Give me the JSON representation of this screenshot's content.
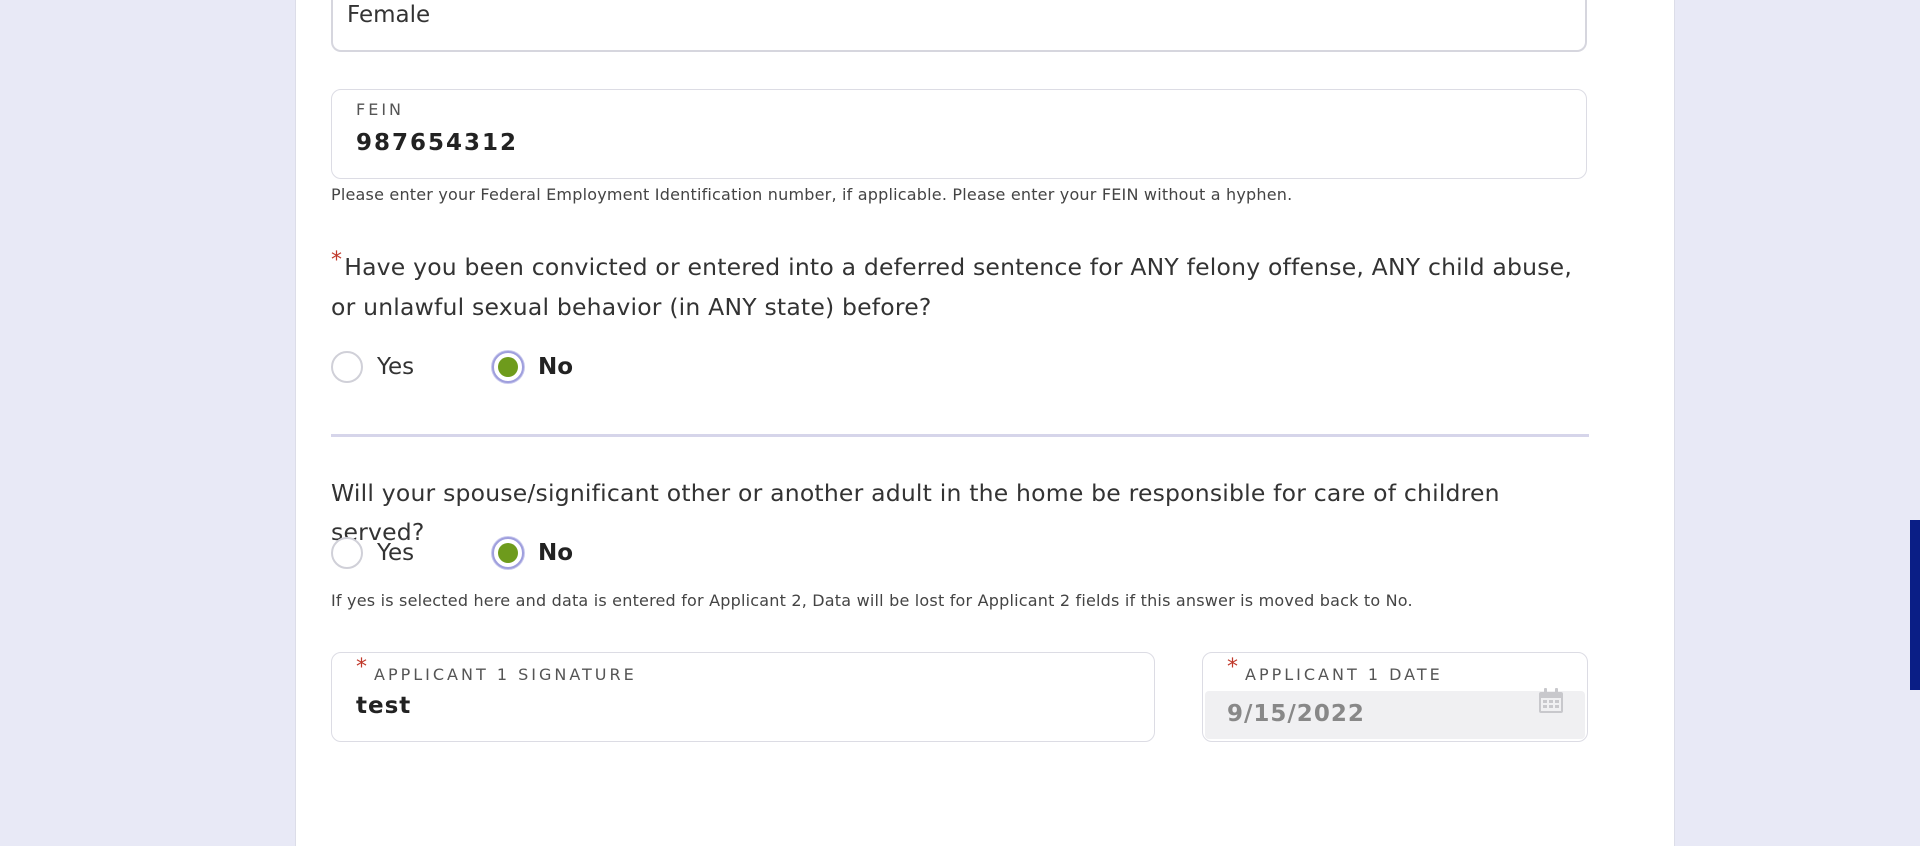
{
  "gender": {
    "value": "Female"
  },
  "fein": {
    "label": "FEIN",
    "value": "987654312",
    "help": "Please enter your Federal Employment Identification number, if applicable. Please enter your FEIN without a hyphen."
  },
  "felony_question": {
    "required_mark": "*",
    "text": "Have you been convicted or entered into a deferred sentence for ANY felony offense, ANY child abuse, or unlawful sexual behavior (in ANY state) before?",
    "options": [
      {
        "label": "Yes",
        "selected": false
      },
      {
        "label": "No",
        "selected": true
      }
    ]
  },
  "spouse_question": {
    "text": "Will your spouse/significant other or another adult in the home be responsible for care of children served?",
    "options": [
      {
        "label": "Yes",
        "selected": false
      },
      {
        "label": "No",
        "selected": true
      }
    ],
    "help": "If yes is selected here and data is entered for Applicant 2, Data will be lost for Applicant 2 fields if this answer is moved back to No."
  },
  "signature": {
    "required_mark": "*",
    "label": "APPLICANT 1 SIGNATURE",
    "value": "test"
  },
  "date": {
    "required_mark": "*",
    "label": "APPLICANT 1 DATE",
    "value": "9/15/2022",
    "icon": "calendar-icon"
  },
  "colors": {
    "selected_radio": "#6e9b1c",
    "required": "#c0392b",
    "scrollbar": "#0a1e86"
  }
}
